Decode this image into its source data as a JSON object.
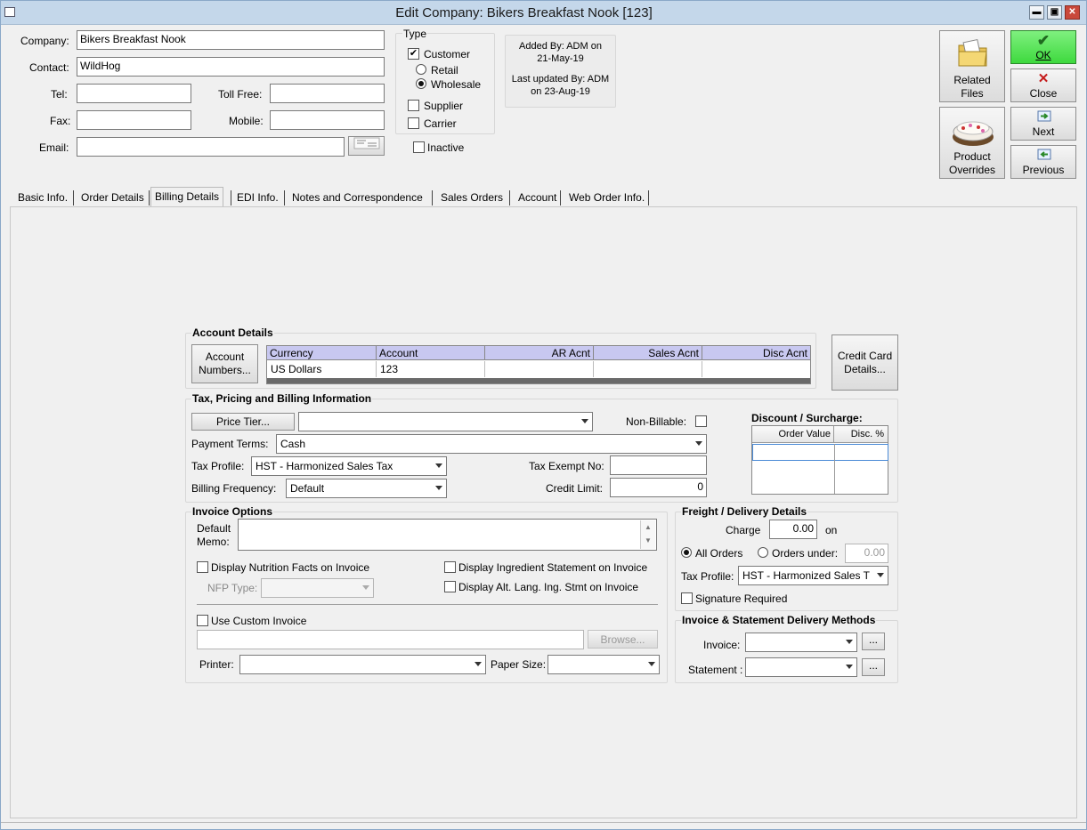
{
  "window": {
    "title": "Edit Company: Bikers Breakfast Nook [123]",
    "min": "▬",
    "max": "▣",
    "close": "✕"
  },
  "company": {
    "company_label": "Company:",
    "company_value": "Bikers Breakfast Nook",
    "contact_label": "Contact:",
    "contact_value": "WildHog",
    "tel_label": "Tel:",
    "tel_value": "",
    "tollfree_label": "Toll Free:",
    "tollfree_value": "",
    "fax_label": "Fax:",
    "fax_value": "",
    "mobile_label": "Mobile:",
    "mobile_value": "",
    "email_label": "Email:",
    "email_value": ""
  },
  "type": {
    "title": "Type",
    "customer": "Customer",
    "customer_checked": true,
    "retail": "Retail",
    "wholesale": "Wholesale",
    "selected": "Wholesale",
    "supplier": "Supplier",
    "carrier": "Carrier",
    "inactive": "Inactive"
  },
  "audit": {
    "added_line1": "Added By: ADM on",
    "added_line2": "21-May-19",
    "updated_line1": "Last updated By: ADM",
    "updated_line2": "on 23-Aug-19"
  },
  "actions": {
    "related_files": "Related",
    "related_files2": "Files",
    "product_overrides": "Product",
    "product_overrides2": "Overrides",
    "ok": "OK",
    "close": "Close",
    "next": "Next",
    "previous": "Previous"
  },
  "tabs": [
    "Basic Info.",
    "Order Details",
    "Billing Details",
    "EDI Info.",
    "Notes and Correspondence",
    "Sales Orders",
    "Account",
    "Web Order Info."
  ],
  "account_details": {
    "title": "Account Details",
    "button": "Account Numbers...",
    "columns": [
      "Currency",
      "Account",
      "AR Acnt",
      "Sales Acnt",
      "Disc Acnt"
    ],
    "rows": [
      [
        "US Dollars",
        "123",
        "",
        "",
        ""
      ]
    ],
    "credit_card_button": "Credit Card Details..."
  },
  "tax_pricing": {
    "title": "Tax, Pricing and Billing Information",
    "price_tier_button": "Price Tier...",
    "price_tier_value": "",
    "non_billable_label": "Non-Billable:",
    "payment_terms_label": "Payment Terms:",
    "payment_terms_value": "Cash",
    "tax_profile_label": "Tax Profile:",
    "tax_profile_value": "HST - Harmonized Sales Tax",
    "tax_exempt_label": "Tax Exempt No:",
    "tax_exempt_value": "",
    "billing_freq_label": "Billing Frequency:",
    "billing_freq_value": "Default",
    "credit_limit_label": "Credit Limit:",
    "credit_limit_value": "0",
    "discount_title": "Discount / Surcharge:",
    "discount_columns": [
      "Order Value",
      "Disc. %"
    ]
  },
  "invoice_options": {
    "title": "Invoice Options",
    "memo_label1": "Default",
    "memo_label2": "Memo:",
    "memo_value": "",
    "nutrition": "Display Nutrition Facts on Invoice",
    "ingredient": "Display Ingredient Statement on Invoice",
    "nfp_label": "NFP Type:",
    "nfp_value": "",
    "alt_lang": "Display Alt. Lang. Ing. Stmt on Invoice",
    "custom_invoice": "Use Custom Invoice",
    "custom_path": "",
    "browse": "Browse...",
    "printer_label": "Printer:",
    "printer_value": "",
    "paper_label": "Paper Size:",
    "paper_value": ""
  },
  "freight": {
    "title": "Freight / Delivery Details",
    "charge_label": "Charge",
    "charge_value": "0.00",
    "on_label": "on",
    "all_orders": "All Orders",
    "orders_under": "Orders under:",
    "orders_under_value": "0.00",
    "tax_profile_label": "Tax Profile:",
    "tax_profile_value": "HST - Harmonized Sales T",
    "signature": "Signature Required"
  },
  "delivery": {
    "title": "Invoice & Statement Delivery Methods",
    "invoice_label": "Invoice:",
    "invoice_value": "",
    "statement_label": "Statement :",
    "statement_value": "",
    "ellipsis": "..."
  }
}
